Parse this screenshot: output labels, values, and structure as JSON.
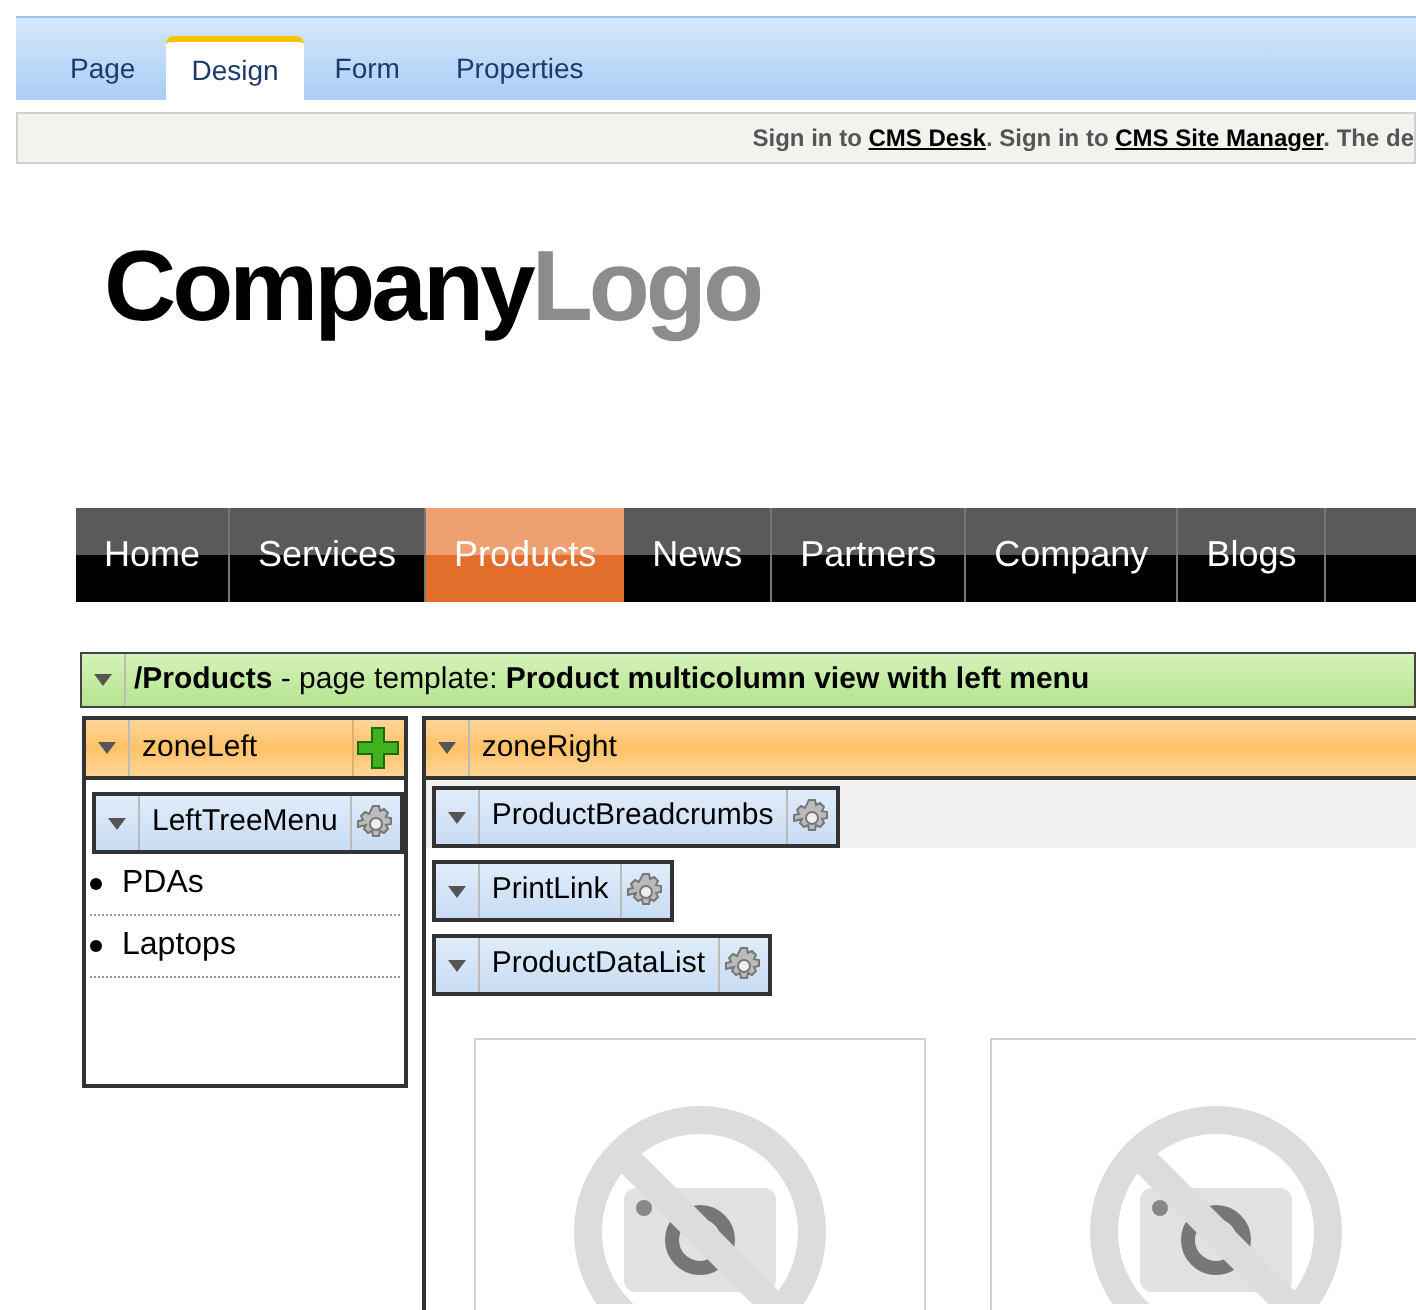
{
  "tabs": [
    {
      "label": "Page",
      "selected": false
    },
    {
      "label": "Design",
      "selected": true
    },
    {
      "label": "Form",
      "selected": false
    },
    {
      "label": "Properties",
      "selected": false
    }
  ],
  "sign_in_bar": {
    "parts": [
      {
        "kind": "text",
        "text": "Sign in to"
      },
      {
        "kind": "link",
        "text": "CMS Desk"
      },
      {
        "kind": "text",
        "text": ". Sign in to"
      },
      {
        "kind": "link",
        "text": "CMS Site Manager"
      },
      {
        "kind": "text",
        "text": ". The de"
      }
    ]
  },
  "logo": {
    "dark": "Company",
    "light": "Logo"
  },
  "nav": [
    {
      "label": "Home",
      "selected": false
    },
    {
      "label": "Services",
      "selected": false
    },
    {
      "label": "Products",
      "selected": true
    },
    {
      "label": "News",
      "selected": false
    },
    {
      "label": "Partners",
      "selected": false
    },
    {
      "label": "Company",
      "selected": false
    },
    {
      "label": "Blogs",
      "selected": false
    }
  ],
  "template_bar": {
    "text": "**/Products** - page template: **Product multicolumn view with left menu**"
  },
  "zones": [
    {
      "title": "zoneLeft",
      "add_button": true,
      "webparts": [
        {
          "title": "LeftTreeMenu"
        }
      ],
      "menu_items": [
        "PDAs",
        "Laptops"
      ]
    },
    {
      "title": "zoneRight",
      "add_button": false,
      "webparts": [
        {
          "title": "ProductBreadcrumbs"
        },
        {
          "title": "PrintLink"
        },
        {
          "title": "ProductDataList"
        }
      ],
      "image_placeholders": [
        {
          "kind": "no-image"
        },
        {
          "kind": "no-image"
        }
      ]
    }
  ]
}
